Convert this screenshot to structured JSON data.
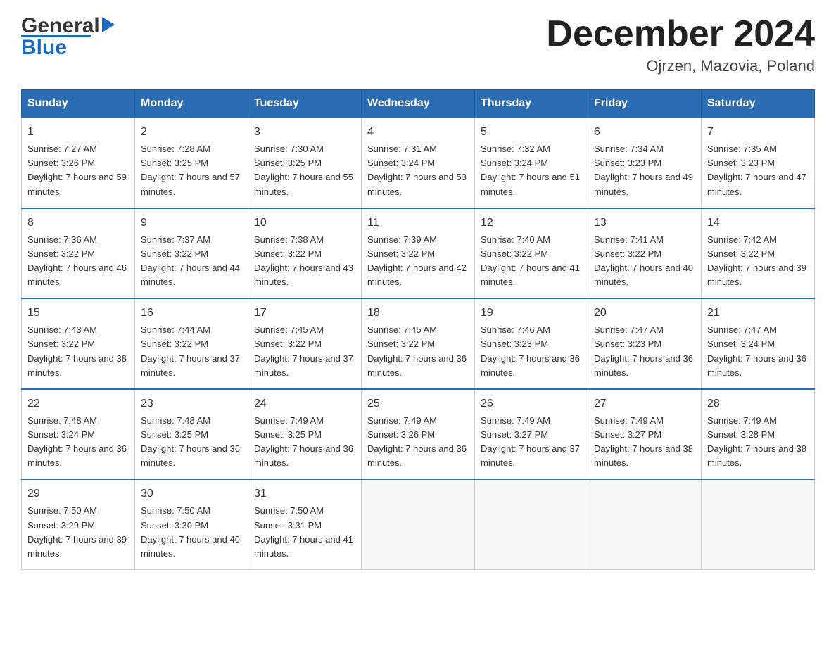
{
  "logo": {
    "general": "General",
    "triangle": "▶",
    "blue": "Blue"
  },
  "title": "December 2024",
  "location": "Ojrzen, Mazovia, Poland",
  "headers": [
    "Sunday",
    "Monday",
    "Tuesday",
    "Wednesday",
    "Thursday",
    "Friday",
    "Saturday"
  ],
  "weeks": [
    [
      {
        "day": "1",
        "sunrise": "7:27 AM",
        "sunset": "3:26 PM",
        "daylight": "7 hours and 59 minutes."
      },
      {
        "day": "2",
        "sunrise": "7:28 AM",
        "sunset": "3:25 PM",
        "daylight": "7 hours and 57 minutes."
      },
      {
        "day": "3",
        "sunrise": "7:30 AM",
        "sunset": "3:25 PM",
        "daylight": "7 hours and 55 minutes."
      },
      {
        "day": "4",
        "sunrise": "7:31 AM",
        "sunset": "3:24 PM",
        "daylight": "7 hours and 53 minutes."
      },
      {
        "day": "5",
        "sunrise": "7:32 AM",
        "sunset": "3:24 PM",
        "daylight": "7 hours and 51 minutes."
      },
      {
        "day": "6",
        "sunrise": "7:34 AM",
        "sunset": "3:23 PM",
        "daylight": "7 hours and 49 minutes."
      },
      {
        "day": "7",
        "sunrise": "7:35 AM",
        "sunset": "3:23 PM",
        "daylight": "7 hours and 47 minutes."
      }
    ],
    [
      {
        "day": "8",
        "sunrise": "7:36 AM",
        "sunset": "3:22 PM",
        "daylight": "7 hours and 46 minutes."
      },
      {
        "day": "9",
        "sunrise": "7:37 AM",
        "sunset": "3:22 PM",
        "daylight": "7 hours and 44 minutes."
      },
      {
        "day": "10",
        "sunrise": "7:38 AM",
        "sunset": "3:22 PM",
        "daylight": "7 hours and 43 minutes."
      },
      {
        "day": "11",
        "sunrise": "7:39 AM",
        "sunset": "3:22 PM",
        "daylight": "7 hours and 42 minutes."
      },
      {
        "day": "12",
        "sunrise": "7:40 AM",
        "sunset": "3:22 PM",
        "daylight": "7 hours and 41 minutes."
      },
      {
        "day": "13",
        "sunrise": "7:41 AM",
        "sunset": "3:22 PM",
        "daylight": "7 hours and 40 minutes."
      },
      {
        "day": "14",
        "sunrise": "7:42 AM",
        "sunset": "3:22 PM",
        "daylight": "7 hours and 39 minutes."
      }
    ],
    [
      {
        "day": "15",
        "sunrise": "7:43 AM",
        "sunset": "3:22 PM",
        "daylight": "7 hours and 38 minutes."
      },
      {
        "day": "16",
        "sunrise": "7:44 AM",
        "sunset": "3:22 PM",
        "daylight": "7 hours and 37 minutes."
      },
      {
        "day": "17",
        "sunrise": "7:45 AM",
        "sunset": "3:22 PM",
        "daylight": "7 hours and 37 minutes."
      },
      {
        "day": "18",
        "sunrise": "7:45 AM",
        "sunset": "3:22 PM",
        "daylight": "7 hours and 36 minutes."
      },
      {
        "day": "19",
        "sunrise": "7:46 AM",
        "sunset": "3:23 PM",
        "daylight": "7 hours and 36 minutes."
      },
      {
        "day": "20",
        "sunrise": "7:47 AM",
        "sunset": "3:23 PM",
        "daylight": "7 hours and 36 minutes."
      },
      {
        "day": "21",
        "sunrise": "7:47 AM",
        "sunset": "3:24 PM",
        "daylight": "7 hours and 36 minutes."
      }
    ],
    [
      {
        "day": "22",
        "sunrise": "7:48 AM",
        "sunset": "3:24 PM",
        "daylight": "7 hours and 36 minutes."
      },
      {
        "day": "23",
        "sunrise": "7:48 AM",
        "sunset": "3:25 PM",
        "daylight": "7 hours and 36 minutes."
      },
      {
        "day": "24",
        "sunrise": "7:49 AM",
        "sunset": "3:25 PM",
        "daylight": "7 hours and 36 minutes."
      },
      {
        "day": "25",
        "sunrise": "7:49 AM",
        "sunset": "3:26 PM",
        "daylight": "7 hours and 36 minutes."
      },
      {
        "day": "26",
        "sunrise": "7:49 AM",
        "sunset": "3:27 PM",
        "daylight": "7 hours and 37 minutes."
      },
      {
        "day": "27",
        "sunrise": "7:49 AM",
        "sunset": "3:27 PM",
        "daylight": "7 hours and 38 minutes."
      },
      {
        "day": "28",
        "sunrise": "7:49 AM",
        "sunset": "3:28 PM",
        "daylight": "7 hours and 38 minutes."
      }
    ],
    [
      {
        "day": "29",
        "sunrise": "7:50 AM",
        "sunset": "3:29 PM",
        "daylight": "7 hours and 39 minutes."
      },
      {
        "day": "30",
        "sunrise": "7:50 AM",
        "sunset": "3:30 PM",
        "daylight": "7 hours and 40 minutes."
      },
      {
        "day": "31",
        "sunrise": "7:50 AM",
        "sunset": "3:31 PM",
        "daylight": "7 hours and 41 minutes."
      },
      null,
      null,
      null,
      null
    ]
  ],
  "labels": {
    "sunrise_prefix": "Sunrise: ",
    "sunset_prefix": "Sunset: ",
    "daylight_prefix": "Daylight: "
  }
}
